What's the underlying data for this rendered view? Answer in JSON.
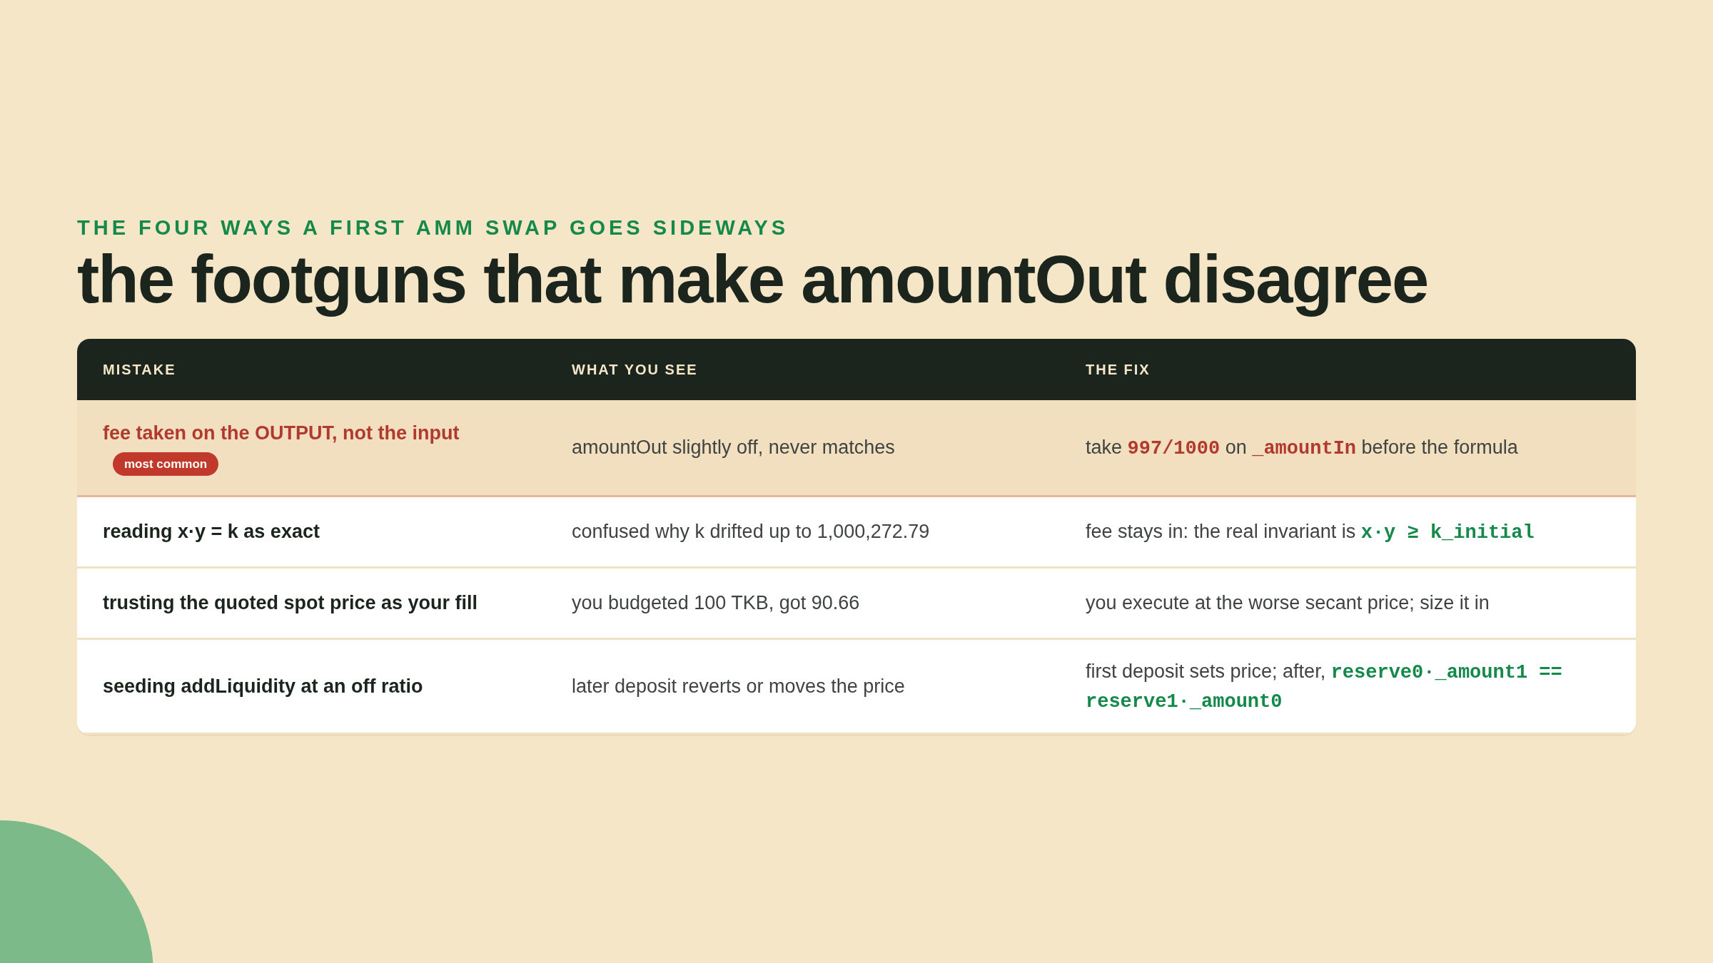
{
  "eyebrow": "THE FOUR WAYS A FIRST AMM SWAP GOES SIDEWAYS",
  "title": "the footguns that make amountOut disagree",
  "table": {
    "columns": [
      "MISTAKE",
      "WHAT YOU SEE",
      "THE FIX"
    ],
    "rows": [
      {
        "highlighted": true,
        "mistake": "fee taken on the OUTPUT, not the input",
        "badge": "most common",
        "seen": "amountOut slightly off, never matches",
        "fix": [
          {
            "kind": "text",
            "text": "take "
          },
          {
            "kind": "code",
            "text": "997/1000",
            "color": "#b03a2e"
          },
          {
            "kind": "text",
            "text": " on "
          },
          {
            "kind": "code",
            "text": "_amountIn",
            "color": "#b03a2e"
          },
          {
            "kind": "text",
            "text": " before the formula"
          }
        ]
      },
      {
        "highlighted": false,
        "mistake": "reading x·y = k as exact",
        "seen": "confused why k drifted up to 1,000,272.79",
        "fix": [
          {
            "kind": "text",
            "text": "fee stays in: the real invariant is "
          },
          {
            "kind": "code",
            "text": "x·y ≥ k_initial",
            "color": "#15894a"
          }
        ]
      },
      {
        "highlighted": false,
        "mistake": "trusting the quoted spot price as your fill",
        "seen": "you budgeted 100 TKB, got 90.66",
        "fix": [
          {
            "kind": "text",
            "text": "you execute at the worse secant price; size it in"
          }
        ]
      },
      {
        "highlighted": false,
        "mistake": "seeding addLiquidity at an off ratio",
        "seen": "later deposit reverts or moves the price",
        "fix": [
          {
            "kind": "text",
            "text": "first deposit sets price; after, "
          },
          {
            "kind": "code",
            "text": "reserve0·_amount1 == reserve1·_amount0",
            "color": "#15894a"
          }
        ]
      }
    ]
  }
}
